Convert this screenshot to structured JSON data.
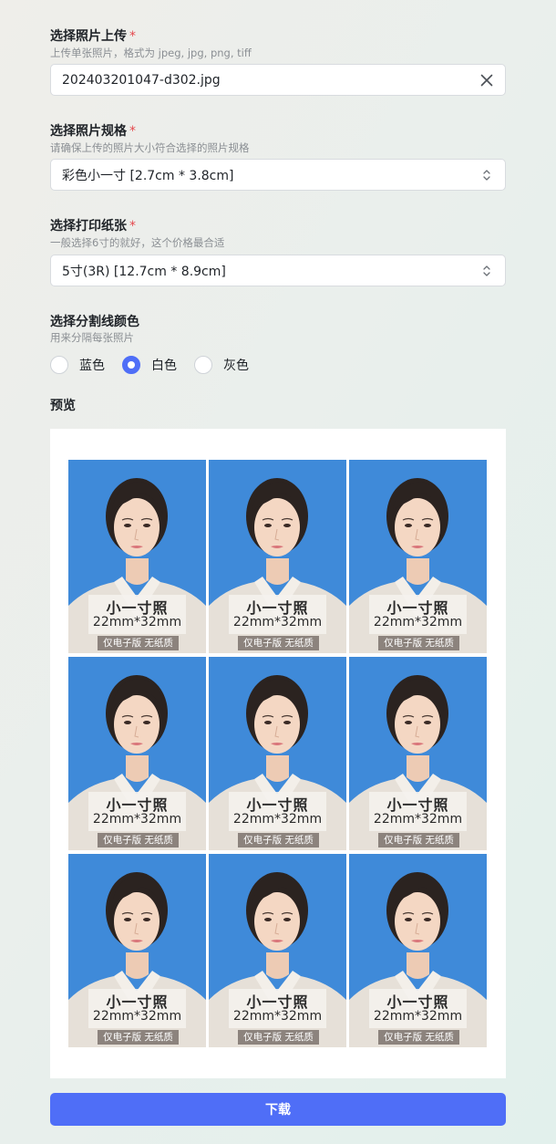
{
  "upload": {
    "label": "选择照片上传",
    "required_mark": "*",
    "hint": "上传单张照片，格式为 jpeg, jpg, png, tiff",
    "value": "202403201047-d302.jpg"
  },
  "spec": {
    "label": "选择照片规格",
    "required_mark": "*",
    "hint": "请确保上传的照片大小符合选择的照片规格",
    "selected": "彩色小一寸 [2.7cm * 3.8cm]"
  },
  "paper": {
    "label": "选择打印纸张",
    "required_mark": "*",
    "hint": "一般选择6寸的就好，这个价格最合适",
    "selected": "5寸(3R) [12.7cm * 8.9cm]"
  },
  "divider": {
    "label": "选择分割线颜色",
    "hint": "用来分隔每张照片",
    "options": [
      {
        "label": "蓝色",
        "checked": false
      },
      {
        "label": "白色",
        "checked": true
      },
      {
        "label": "灰色",
        "checked": false
      }
    ]
  },
  "preview": {
    "label": "预览",
    "photo_title": "小一寸照",
    "photo_size": "22mm*32mm",
    "photo_tag": "仅电子版 无纸质",
    "photo_bg_color": "#3f8ad9",
    "count": 9
  },
  "download_label": "下载",
  "colors": {
    "accent": "#4f6ef7",
    "required": "#e5484d"
  }
}
